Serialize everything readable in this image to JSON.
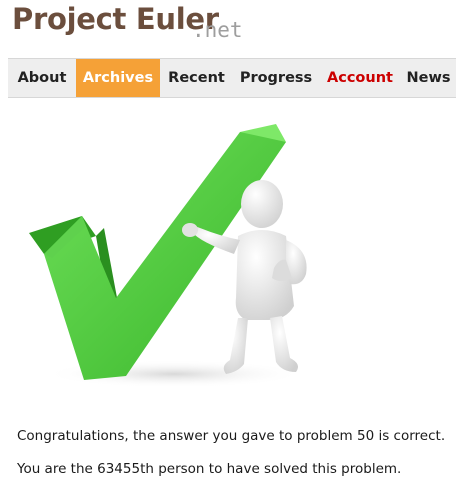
{
  "site": {
    "logo_main": "Project Euler",
    "logo_suffix": ".net",
    "brand_color": "#6b4e3d",
    "suffix_color": "#9e9e9e"
  },
  "nav": {
    "items": [
      {
        "label": "About"
      },
      {
        "label": "Archives"
      },
      {
        "label": "Recent"
      },
      {
        "label": "Progress"
      },
      {
        "label": "Account"
      },
      {
        "label": "News"
      }
    ],
    "active": "Archives",
    "active_color": "#f5a137",
    "account_color": "#cc0000",
    "background": "#eeeeee"
  },
  "illustration": {
    "icon": "checkmark-with-figure-icon",
    "checkmark_color": "#4cc63c"
  },
  "result": {
    "message": "Congratulations, the answer you gave to problem 50 is correct.",
    "rank_message": "You are the 63455th person to have solved this problem."
  }
}
